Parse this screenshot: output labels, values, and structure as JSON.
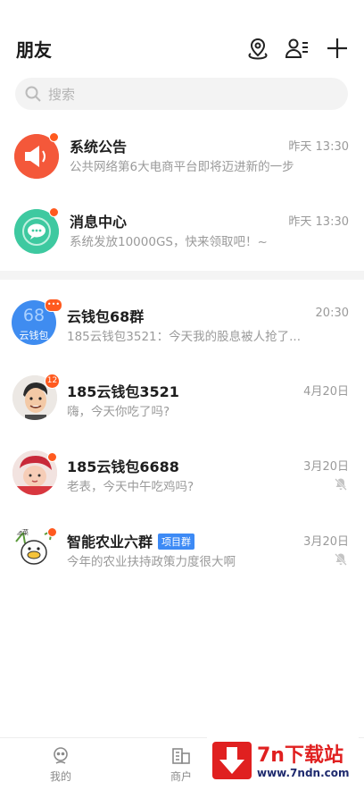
{
  "header": {
    "title": "朋友"
  },
  "search": {
    "placeholder": "搜索"
  },
  "system_items": [
    {
      "name": "系统公告",
      "time": "昨天 13:30",
      "preview": "公共网络第6大电商平台即将迈进新的一步",
      "icon": "speaker-icon",
      "color": "#f4583a"
    },
    {
      "name": "消息中心",
      "time": "昨天 13:30",
      "preview": "系统发放10000GS，快来领取吧！~",
      "icon": "chat-bubble-icon",
      "color": "#3ec9a0"
    }
  ],
  "chats": [
    {
      "name": "云钱包68群",
      "avatar_text_top": "68",
      "avatar_text_bottom": "云钱包",
      "time": "20:30",
      "preview": "185云钱包3521：今天我的股息被人抢了...",
      "badge": "•••",
      "muted": false
    },
    {
      "name": "185云钱包3521",
      "time": "4月20日",
      "preview": "嗨，今天你吃了吗?",
      "badge": "12",
      "muted": false
    },
    {
      "name": "185云钱包6688",
      "time": "3月20日",
      "preview": "老表，今天中午吃鸡吗?",
      "muted": true
    },
    {
      "name": "智能农业六群",
      "tag": "项目群",
      "time": "3月20日",
      "preview": "今年的农业扶持政策力度很大啊",
      "muted": true
    }
  ],
  "tabbar": {
    "tabs": [
      {
        "label": "我的",
        "icon": "user-face-icon"
      },
      {
        "label": "商户",
        "icon": "merchant-icon"
      }
    ]
  },
  "watermark": {
    "title": "7n下载站",
    "url": "www.7ndn.com"
  },
  "colors": {
    "badge": "#ff5a1f",
    "tag": "#3d8af5",
    "watermark_red": "#e02020"
  }
}
